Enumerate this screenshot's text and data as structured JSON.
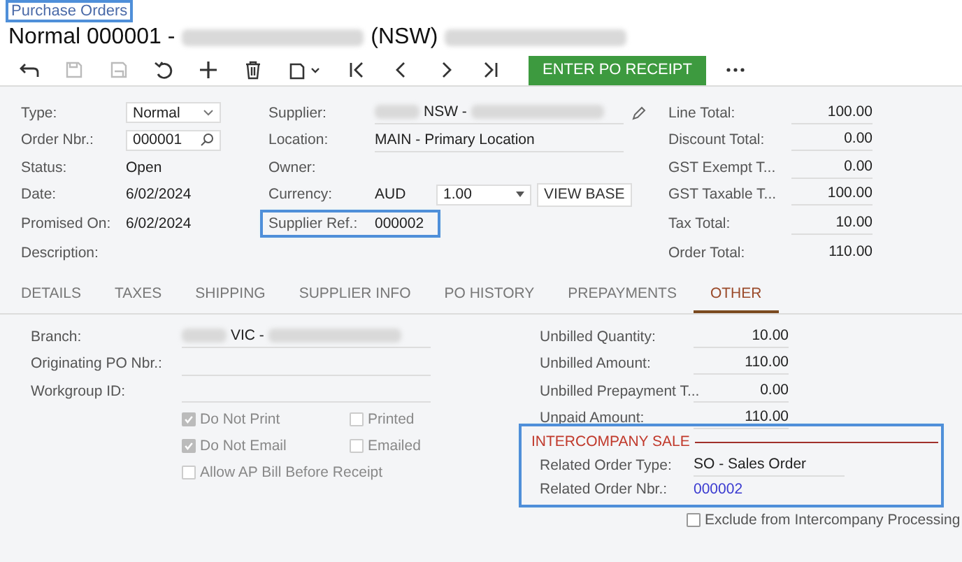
{
  "breadcrumb": {
    "text": "Purchase Orders",
    "highlighted": true
  },
  "title": [
    {
      "kind": "text",
      "text": "Normal 000001 -"
    },
    {
      "kind": "redacted"
    },
    {
      "kind": "text",
      "text": "(NSW)"
    },
    {
      "kind": "redacted"
    }
  ],
  "toolbar": [
    {
      "kind": "back",
      "disabled": false
    },
    {
      "kind": "save",
      "disabled": true
    },
    {
      "kind": "save-close",
      "disabled": true
    },
    {
      "kind": "undo",
      "disabled": false
    },
    {
      "kind": "add",
      "disabled": false
    },
    {
      "kind": "delete",
      "disabled": false
    },
    {
      "kind": "copy",
      "disabled": false
    },
    {
      "kind": "first",
      "disabled": false
    },
    {
      "kind": "prev",
      "disabled": false
    },
    {
      "kind": "next",
      "disabled": false
    },
    {
      "kind": "last",
      "disabled": false
    }
  ],
  "primary_button": "ENTER PO RECEIPT",
  "left_fields": [
    {
      "label": "Type:",
      "value": "Normal",
      "kind": "dropdown"
    },
    {
      "label": "Order Nbr.:",
      "value": "000001",
      "kind": "search"
    },
    {
      "label": "Status:",
      "value": "Open",
      "kind": "text"
    },
    {
      "label": "Date:",
      "value": "6/02/2024",
      "kind": "text"
    },
    {
      "label": "Promised On:",
      "value": "6/02/2024",
      "kind": "text"
    },
    {
      "label": "Description:",
      "kind": "text"
    }
  ],
  "supplier": {
    "label": "Supplier:",
    "segments": [
      {
        "kind": "redacted"
      },
      {
        "kind": "text",
        "text": "NSW -"
      },
      {
        "kind": "redacted"
      }
    ]
  },
  "location": {
    "label": "Location:",
    "value": "MAIN - Primary Location"
  },
  "owner": {
    "label": "Owner:"
  },
  "currency": {
    "label": "Currency:",
    "value": "AUD",
    "rate": "1.00",
    "button": "VIEW BASE"
  },
  "supplier_ref": {
    "label": "Supplier Ref.:",
    "value": "000002",
    "highlighted": true
  },
  "totals": [
    {
      "label": "Line Total:",
      "value": "100.00"
    },
    {
      "label": "Discount Total:",
      "value": "0.00"
    },
    {
      "label": "GST Exempt T...",
      "value": "0.00"
    },
    {
      "label": "GST Taxable T...",
      "value": "100.00"
    },
    {
      "label": "Tax Total:",
      "value": "10.00"
    },
    {
      "label": "Order Total:",
      "value": "110.00"
    }
  ],
  "tabs": [
    {
      "label": "DETAILS",
      "selected": false
    },
    {
      "label": "TAXES",
      "selected": false
    },
    {
      "label": "SHIPPING",
      "selected": false
    },
    {
      "label": "SUPPLIER INFO",
      "selected": false
    },
    {
      "label": "PO HISTORY",
      "selected": false
    },
    {
      "label": "PREPAYMENTS",
      "selected": false
    },
    {
      "label": "OTHER",
      "selected": true
    }
  ],
  "branch": {
    "label": "Branch:",
    "segments": [
      {
        "kind": "redacted"
      },
      {
        "kind": "text",
        "text": "VIC -"
      },
      {
        "kind": "redacted"
      }
    ]
  },
  "originating": {
    "label": "Originating PO Nbr.:"
  },
  "workgroup": {
    "label": "Workgroup ID:"
  },
  "checkboxes": [
    {
      "label": "Do Not Print",
      "checked": true,
      "disabled": true
    },
    {
      "label": "Printed",
      "checked": false,
      "disabled": true
    },
    {
      "label": "Do Not Email",
      "checked": true,
      "disabled": true
    },
    {
      "label": "Emailed",
      "checked": false,
      "disabled": true
    },
    {
      "label": "Allow AP Bill Before Receipt",
      "checked": false,
      "disabled": true
    }
  ],
  "unbilled": [
    {
      "label": "Unbilled Quantity:",
      "value": "10.00"
    },
    {
      "label": "Unbilled Amount:",
      "value": "110.00"
    },
    {
      "label": "Unbilled Prepayment T...",
      "value": "0.00"
    },
    {
      "label": "Unpaid Amount:",
      "value": "110.00"
    }
  ],
  "intercompany": {
    "title": "INTERCOMPANY SALE",
    "highlighted": true,
    "order_type": {
      "label": "Related Order Type:",
      "value": "SO - Sales Order"
    },
    "order_nbr": {
      "label": "Related Order Nbr.:",
      "value": "000002"
    }
  },
  "exclude": {
    "label": "Exclude from Intercompany Processing",
    "checked": false,
    "disabled": false
  }
}
